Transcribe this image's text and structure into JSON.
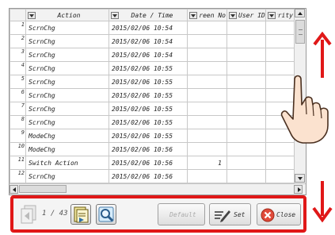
{
  "table": {
    "columns": [
      {
        "label": "Action"
      },
      {
        "label": "Date / Time"
      },
      {
        "label": "Screen No"
      },
      {
        "label": "User ID"
      },
      {
        "label": "Security"
      }
    ],
    "rows": [
      {
        "num": "1",
        "action": "ScrnChg",
        "datetime": "2015/02/06 10:54",
        "screen": ""
      },
      {
        "num": "2",
        "action": "ScrnChg",
        "datetime": "2015/02/06 10:54",
        "screen": ""
      },
      {
        "num": "3",
        "action": "ScrnChg",
        "datetime": "2015/02/06 10:54",
        "screen": ""
      },
      {
        "num": "4",
        "action": "ScrnChg",
        "datetime": "2015/02/06 10:55",
        "screen": ""
      },
      {
        "num": "5",
        "action": "ScrnChg",
        "datetime": "2015/02/06 10:55",
        "screen": ""
      },
      {
        "num": "6",
        "action": "ScrnChg",
        "datetime": "2015/02/06 10:55",
        "screen": ""
      },
      {
        "num": "7",
        "action": "ScrnChg",
        "datetime": "2015/02/06 10:55",
        "screen": ""
      },
      {
        "num": "8",
        "action": "ScrnChg",
        "datetime": "2015/02/06 10:55",
        "screen": ""
      },
      {
        "num": "9",
        "action": "ModeChg",
        "datetime": "2015/02/06 10:55",
        "screen": ""
      },
      {
        "num": "10",
        "action": "ModeChg",
        "datetime": "2015/02/06 10:56",
        "screen": ""
      },
      {
        "num": "11",
        "action": "Switch Action",
        "datetime": "2015/02/06 10:56",
        "screen": "1"
      },
      {
        "num": "12",
        "action": "ScrnChg",
        "datetime": "2015/02/06 10:56",
        "screen": ""
      }
    ]
  },
  "toolbar": {
    "page_text": "1 / 43",
    "default_label": "Default",
    "set_label": "Set",
    "close_label": "Close"
  },
  "colors": {
    "highlight": "#e01818",
    "close_icon": "#e04a3a"
  },
  "icons": [
    "page-prev-icon",
    "page-next-icon",
    "search-icon",
    "set-pencil-icon",
    "close-x-icon",
    "scroll-up-arrow-icon",
    "scroll-down-arrow-icon",
    "hand-pointer-icon"
  ]
}
